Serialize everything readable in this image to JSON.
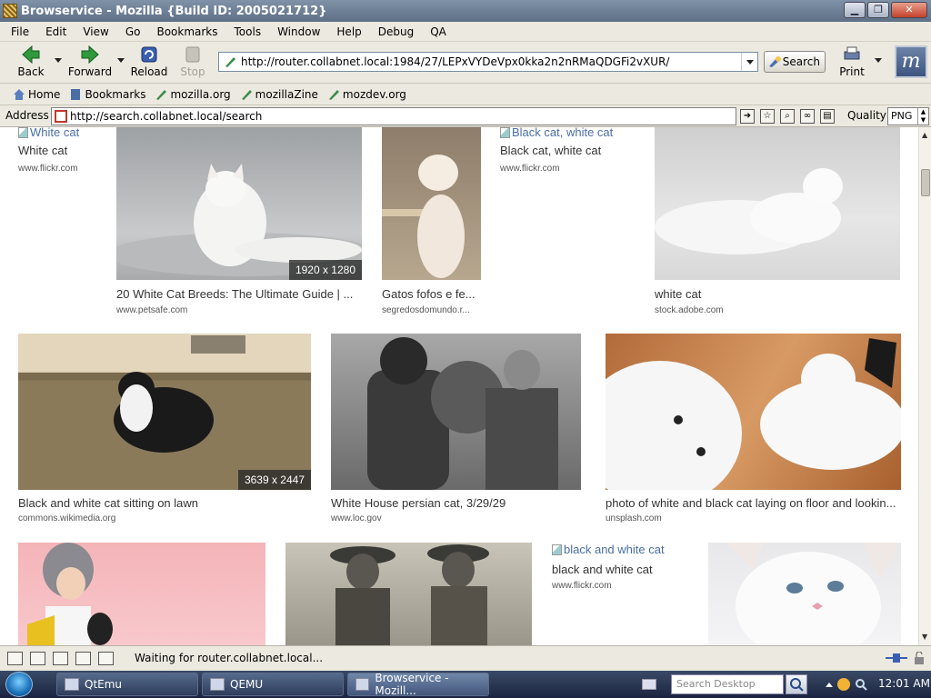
{
  "window": {
    "title": "Browservice - Mozilla {Build ID: 2005021712}"
  },
  "menu": [
    "File",
    "Edit",
    "View",
    "Go",
    "Bookmarks",
    "Tools",
    "Window",
    "Help",
    "Debug",
    "QA"
  ],
  "nav": {
    "back": "Back",
    "forward": "Forward",
    "reload": "Reload",
    "stop": "Stop",
    "url": "http://router.collabnet.local:1984/27/LEPxVYDeVpx0kka2n2nRMaQDGFi2vXUR/",
    "search": "Search",
    "print": "Print"
  },
  "bookmarks": [
    "Home",
    "Bookmarks",
    "mozilla.org",
    "mozillaZine",
    "mozdev.org"
  ],
  "addressbar": {
    "label": "Address",
    "url": "http://search.collabnet.local/search",
    "quality_label": "Quality",
    "quality_value": "PNG"
  },
  "results": [
    {
      "caption": "White cat",
      "source": "www.flickr.com",
      "alt": "White cat",
      "broken": true
    },
    {
      "caption": "20 White Cat Breeds: The Ultimate Guide | ...",
      "source": "www.petsafe.com",
      "dims": "1920 x 1280"
    },
    {
      "caption": "Gatos fofos e fe...",
      "source": "segredosdomundo.r..."
    },
    {
      "caption": "Black cat, white cat",
      "source": "www.flickr.com",
      "alt": "Black cat, white cat",
      "broken": true
    },
    {
      "caption": "white cat",
      "source": "stock.adobe.com"
    },
    {
      "caption": "Black and white cat sitting on lawn",
      "source": "commons.wikimedia.org",
      "dims": "3639 x 2447"
    },
    {
      "caption": "White House persian cat, 3/29/29",
      "source": "www.loc.gov"
    },
    {
      "caption": "photo of white and black cat laying on floor and lookin...",
      "source": "unsplash.com"
    },
    {
      "caption": "",
      "source": ""
    },
    {
      "caption": "",
      "source": ""
    },
    {
      "caption": "black and white cat",
      "source": "www.flickr.com",
      "alt": "black and white cat",
      "broken": true
    },
    {
      "caption": "",
      "source": ""
    }
  ],
  "status": {
    "text": "Waiting for router.collabnet.local..."
  },
  "taskbar": {
    "items": [
      "QtEmu",
      "QEMU",
      "Browservice - Mozill..."
    ],
    "search_placeholder": "Search Desktop",
    "clock": "12:01 AM"
  },
  "colors": {
    "titlebar": "#5e6f86",
    "link": "#4a6fa5",
    "taskbar": "#1a2440"
  }
}
